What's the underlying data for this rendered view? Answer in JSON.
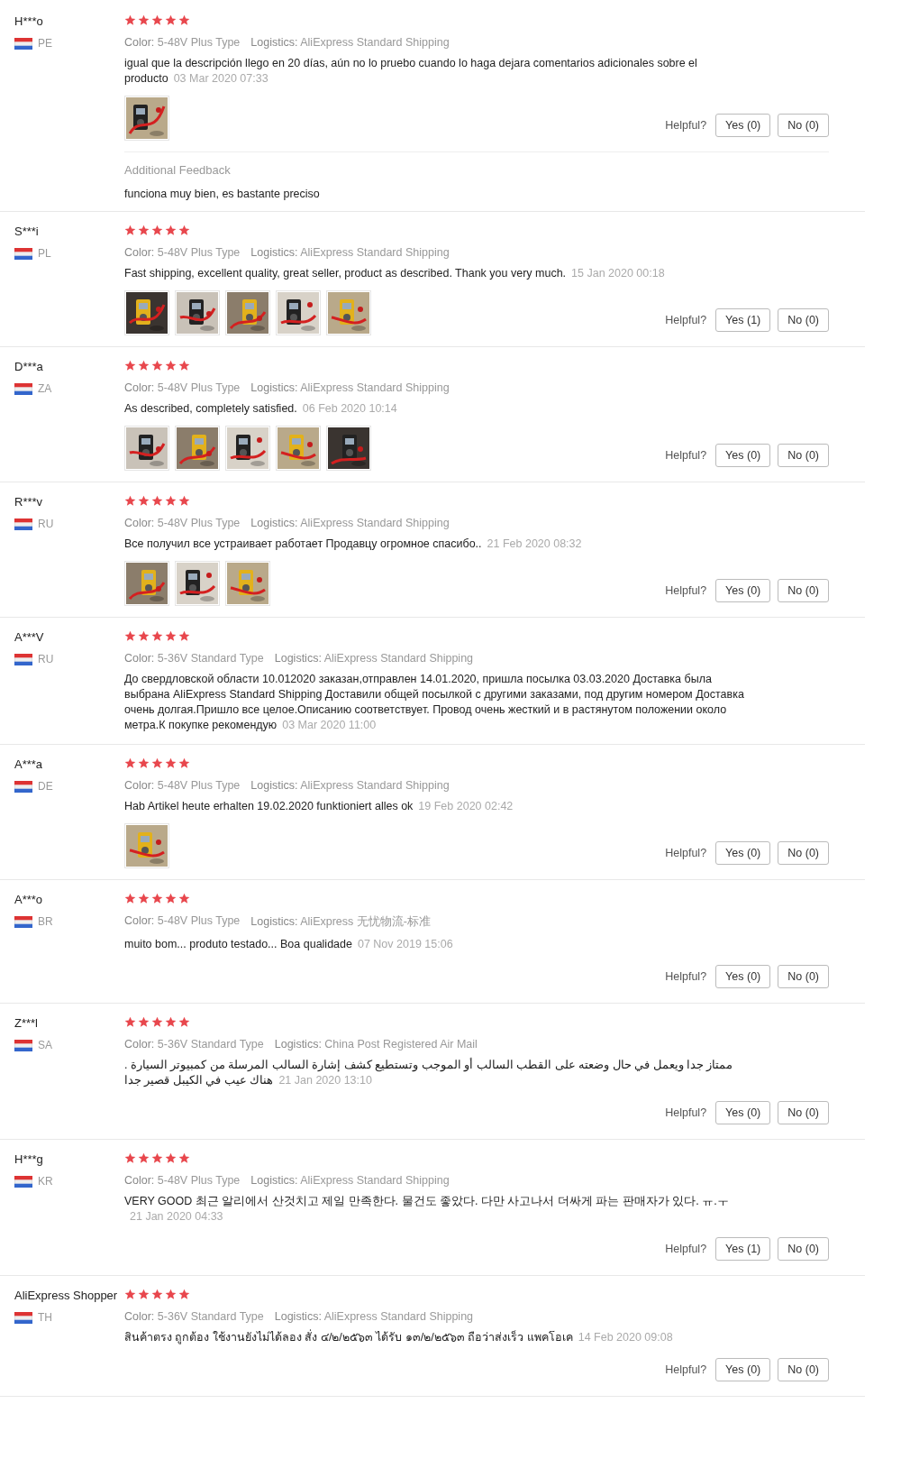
{
  "reviews": [
    {
      "name": "H***o",
      "country": "PE",
      "stars": 5,
      "spec": {
        "label": "Color:",
        "value": "5-48V Plus Type"
      },
      "logistics": {
        "label": "Logistics:",
        "value": "AliExpress Standard Shipping"
      },
      "text": "igual que la descripción llego en 20 días, aún no lo pruebo cuando lo haga dejara comentarios adicionales sobre el producto",
      "date": "03 Mar 2020 07:33",
      "photos": [
        {
          "kind": "picture"
        }
      ],
      "helpful": {
        "label": "Helpful?",
        "yes": "Yes (0)",
        "no": "No (0)"
      },
      "additional": {
        "title": "Additional Feedback",
        "text": "funciona muy bien, es bastante preciso"
      }
    },
    {
      "name": "S***i",
      "country": "PL",
      "stars": 5,
      "spec": {
        "label": "Color:",
        "value": "5-48V Plus Type"
      },
      "logistics": {
        "label": "Logistics:",
        "value": "AliExpress Standard Shipping"
      },
      "text": "Fast shipping, excellent quality, great seller, product as described. Thank you very much.",
      "date": "15 Jan 2020 00:18",
      "photos": [
        {
          "kind": "picture"
        },
        {
          "kind": "picture"
        },
        {
          "kind": "picture"
        },
        {
          "kind": "picture"
        },
        {
          "kind": "picture"
        }
      ],
      "helpful": {
        "label": "Helpful?",
        "yes": "Yes (1)",
        "no": "No (0)"
      }
    },
    {
      "name": "D***a",
      "country": "ZA",
      "stars": 5,
      "spec": {
        "label": "Color:",
        "value": "5-48V Plus Type"
      },
      "logistics": {
        "label": "Logistics:",
        "value": "AliExpress Standard Shipping"
      },
      "text": "As described, completely satisfied.",
      "date": "06 Feb 2020 10:14",
      "photos": [
        {
          "kind": "picture"
        },
        {
          "kind": "picture"
        },
        {
          "kind": "picture"
        },
        {
          "kind": "picture"
        },
        {
          "kind": "picture"
        }
      ],
      "helpful": {
        "label": "Helpful?",
        "yes": "Yes (0)",
        "no": "No (0)"
      }
    },
    {
      "name": "R***v",
      "country": "RU",
      "stars": 5,
      "spec": {
        "label": "Color:",
        "value": "5-48V Plus Type"
      },
      "logistics": {
        "label": "Logistics:",
        "value": "AliExpress Standard Shipping"
      },
      "text": "Все получил все устраивает работает Продавцу огромное спасибо..",
      "date": "21 Feb 2020 08:32",
      "photos": [
        {
          "kind": "picture"
        },
        {
          "kind": "picture"
        },
        {
          "kind": "picture"
        }
      ],
      "helpful": {
        "label": "Helpful?",
        "yes": "Yes (0)",
        "no": "No (0)"
      }
    },
    {
      "name": "A***V",
      "country": "RU",
      "stars": 5,
      "spec": {
        "label": "Color:",
        "value": "5-36V Standard Type"
      },
      "logistics": {
        "label": "Logistics:",
        "value": "AliExpress Standard Shipping"
      },
      "text": "До свердловской области 10.012020 заказан,отправлен 14.01.2020, пришла посылка 03.03.2020 Доставка была выбрана AliExpress Standard Shipping Доставили общей посылкой с другими заказами, под другим номером Доставка очень долгая.Пришло все целое.Описанию соответствует. Провод очень жесткий и в растянутом положении около метра.К покупке рекомендую",
      "date": "03 Mar 2020 11:00"
    },
    {
      "name": "A***a",
      "country": "DE",
      "stars": 5,
      "spec": {
        "label": "Color:",
        "value": "5-48V Plus Type"
      },
      "logistics": {
        "label": "Logistics:",
        "value": "AliExpress Standard Shipping"
      },
      "text": "Hab Artikel heute erhalten 19.02.2020 funktioniert alles ok",
      "date": "19 Feb 2020 02:42",
      "photos": [
        {
          "kind": "picture"
        }
      ],
      "helpful": {
        "label": "Helpful?",
        "yes": "Yes (0)",
        "no": "No (0)"
      }
    },
    {
      "name": "A***o",
      "country": "BR",
      "stars": 5,
      "spec": {
        "label": "Color:",
        "value": "5-48V Plus Type"
      },
      "logistics": {
        "label": "Logistics:",
        "value": "AliExpress 无忧物流-标准"
      },
      "text": "muito bom... produto testado... Boa qualidade",
      "date": "07 Nov 2019 15:06",
      "helpful": {
        "label": "Helpful?",
        "yes": "Yes (0)",
        "no": "No (0)"
      }
    },
    {
      "name": "Z***l",
      "country": "SA",
      "stars": 5,
      "spec": {
        "label": "Color:",
        "value": "5-36V Standard Type"
      },
      "logistics": {
        "label": "Logistics:",
        "value": "China Post Registered Air Mail"
      },
      "text": "ممتاز جدا ويعمل في حال وضعته على القطب السالب أو الموجب وتستطيع كشف إشارة السالب المرسلة من كمبيوتر السيارة . هناك عيب في الكيبل قصير جدا",
      "date": "21 Jan 2020 13:10",
      "helpful": {
        "label": "Helpful?",
        "yes": "Yes (0)",
        "no": "No (0)"
      }
    },
    {
      "name": "H***g",
      "country": "KR",
      "stars": 5,
      "spec": {
        "label": "Color:",
        "value": "5-48V Plus Type"
      },
      "logistics": {
        "label": "Logistics:",
        "value": "AliExpress Standard Shipping"
      },
      "text": "VERY GOOD 최근 알리에서 산것치고 제일 만족한다. 물건도 좋았다. 다만 사고나서 더싸게 파는 판매자가 있다. ㅠ.ㅜ",
      "date": "21 Jan 2020 04:33",
      "helpful": {
        "label": "Helpful?",
        "yes": "Yes (1)",
        "no": "No (0)"
      }
    },
    {
      "name": "AliExpress Shopper",
      "country": "TH",
      "stars": 5,
      "spec": {
        "label": "Color:",
        "value": "5-36V Standard Type"
      },
      "logistics": {
        "label": "Logistics:",
        "value": "AliExpress Standard Shipping"
      },
      "text": "สินค้าตรง ถูกต้อง ใช้งานยังไม่ได้ลอง สั่ง ๔/๒/๒๕๖๓ ได้รับ ๑๓/๒/๒๕๖๓ ถือว่าส่งเร็ว แพคโอเค",
      "date": "14 Feb 2020 09:08",
      "helpful": {
        "label": "Helpful?",
        "yes": "Yes (0)",
        "no": "No (0)"
      }
    }
  ]
}
